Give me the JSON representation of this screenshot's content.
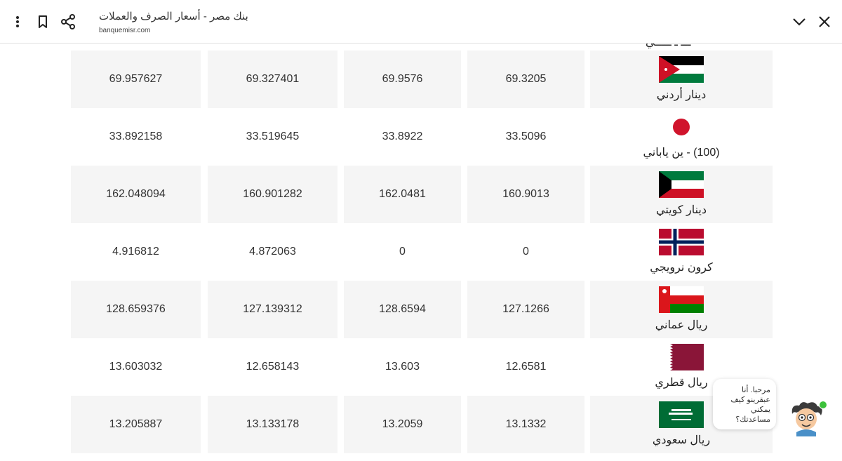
{
  "header": {
    "title": "بنك مصر - أسعار الصرف والعملات",
    "url": "banquemisr.com"
  },
  "icons": {
    "menu": "more-vert-icon",
    "bookmark": "bookmark-icon",
    "share": "share-icon",
    "collapse": "chevron-down-icon",
    "close": "close-icon"
  },
  "rates": [
    {
      "currency": "دينار أردني",
      "flag": "jordan",
      "values": [
        "69.957627",
        "69.327401",
        "69.9576",
        "69.3205"
      ]
    },
    {
      "currency": "(100) - ين ياباني",
      "flag": "japan",
      "values": [
        "33.892158",
        "33.519645",
        "33.8922",
        "33.5096"
      ]
    },
    {
      "currency": "دينار كويتي",
      "flag": "kuwait",
      "values": [
        "162.048094",
        "160.901282",
        "162.0481",
        "160.9013"
      ]
    },
    {
      "currency": "كرون نرويجي",
      "flag": "norway",
      "values": [
        "4.916812",
        "4.872063",
        "0",
        "0"
      ]
    },
    {
      "currency": "ريال عماني",
      "flag": "oman",
      "values": [
        "128.659376",
        "127.139312",
        "128.6594",
        "127.1266"
      ]
    },
    {
      "currency": "ريال قطري",
      "flag": "qatar",
      "values": [
        "13.603032",
        "12.658143",
        "13.603",
        "12.6581"
      ]
    },
    {
      "currency": "ريال سعودي",
      "flag": "saudi",
      "values": [
        "13.205887",
        "13.133178",
        "13.2059",
        "13.1332"
      ]
    }
  ],
  "chat": {
    "message": "مرحبا. أنا عبقرينو كيف يمكني مساعدتك؟"
  },
  "colors": {
    "row_shade": "#f5f5f5",
    "online": "#3cc13b"
  }
}
